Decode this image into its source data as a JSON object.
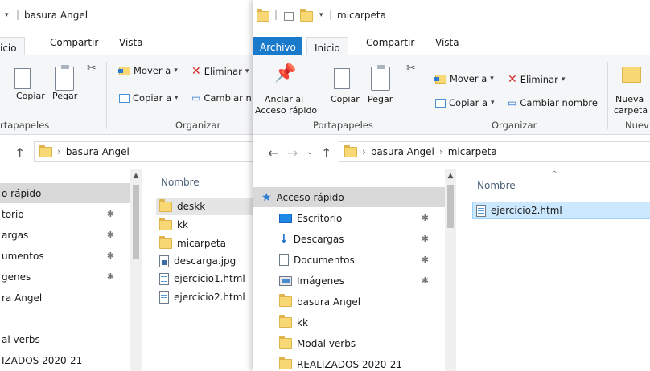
{
  "back_window": {
    "title": "basura Angel",
    "tabs": [
      "icio",
      "Compartir",
      "Vista"
    ],
    "ribbon": {
      "copy_label": "Copiar",
      "paste_label": "Pegar",
      "clipboard_group": "rtapapeles",
      "move_to": "Mover a",
      "copy_to": "Copiar a",
      "delete": "Eliminar",
      "rename": "Cambiar n",
      "organize_group": "Organizar"
    },
    "address": {
      "segment": "basura Angel"
    },
    "nav_items": [
      "o rápido",
      "torio",
      "argas",
      "umentos",
      "genes",
      "ra Angel",
      "",
      "al verbs",
      "IZADOS 2020-21"
    ],
    "column_name": "Nombre",
    "files": [
      {
        "name": "deskk",
        "icon": "folder-icon"
      },
      {
        "name": "kk",
        "icon": "folder-icon"
      },
      {
        "name": "micarpeta",
        "icon": "folder-icon"
      },
      {
        "name": "descarga.jpg",
        "icon": "jpg-file-icon"
      },
      {
        "name": "ejercicio1.html",
        "icon": "html-file-icon"
      },
      {
        "name": "ejercicio2.html",
        "icon": "html-file-icon"
      }
    ]
  },
  "front_window": {
    "title": "micarpeta",
    "tabs": {
      "file": "Archivo",
      "home": "Inicio",
      "share": "Compartir",
      "view": "Vista"
    },
    "ribbon": {
      "pin_label_1": "Anclar al",
      "pin_label_2": "Acceso rápido",
      "copy_label": "Copiar",
      "paste_label": "Pegar",
      "clipboard_group": "Portapapeles",
      "move_to": "Mover a",
      "copy_to": "Copiar a",
      "delete": "Eliminar",
      "rename": "Cambiar nombre",
      "organize_group": "Organizar",
      "new_folder_1": "Nueva",
      "new_folder_2": "carpeta",
      "new_group": "Nuev"
    },
    "address": {
      "segment_1": "basura Angel",
      "segment_2": "micarpeta"
    },
    "nav_items": [
      {
        "label": "Acceso rápido",
        "icon": "star-icon",
        "pinned": false
      },
      {
        "label": "Escritorio",
        "icon": "desktop-icon",
        "pinned": true
      },
      {
        "label": "Descargas",
        "icon": "download-icon",
        "pinned": true
      },
      {
        "label": "Documentos",
        "icon": "documents-icon",
        "pinned": true
      },
      {
        "label": "Imágenes",
        "icon": "pictures-icon",
        "pinned": true
      },
      {
        "label": "basura Angel",
        "icon": "folder-icon",
        "pinned": false
      },
      {
        "label": "kk",
        "icon": "folder-icon",
        "pinned": false
      },
      {
        "label": "Modal verbs",
        "icon": "folder-icon",
        "pinned": false
      },
      {
        "label": "REALIZADOS 2020-21",
        "icon": "folder-icon",
        "pinned": false
      }
    ],
    "column_name": "Nombre",
    "files": [
      {
        "name": "ejercicio2.html",
        "icon": "html-file-icon"
      }
    ]
  },
  "colors": {
    "file_tab": "#1979ca",
    "selection": "#cce8ff",
    "ribbon_bg": "#f5f6f7",
    "delete_x": "#d32f2f"
  }
}
